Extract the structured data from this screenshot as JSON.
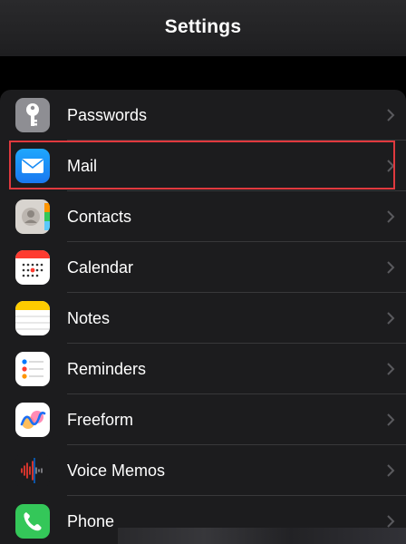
{
  "nav": {
    "title": "Settings"
  },
  "rows": [
    {
      "label": "Passwords",
      "icon": "key-icon"
    },
    {
      "label": "Mail",
      "icon": "mail-icon"
    },
    {
      "label": "Contacts",
      "icon": "contacts-icon"
    },
    {
      "label": "Calendar",
      "icon": "calendar-icon"
    },
    {
      "label": "Notes",
      "icon": "notes-icon"
    },
    {
      "label": "Reminders",
      "icon": "reminders-icon"
    },
    {
      "label": "Freeform",
      "icon": "freeform-icon"
    },
    {
      "label": "Voice Memos",
      "icon": "voice-memos-icon"
    },
    {
      "label": "Phone",
      "icon": "phone-icon"
    }
  ],
  "colors": {
    "highlight": "#e0393e",
    "background": "#000000",
    "group": "#1c1c1e"
  }
}
